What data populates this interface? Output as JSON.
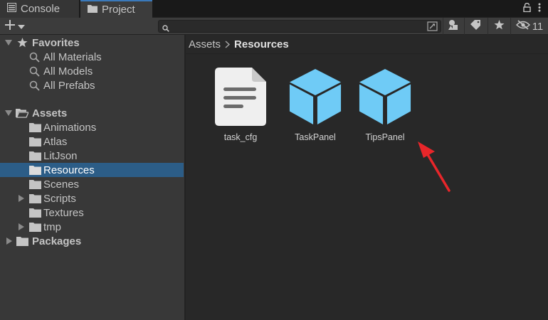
{
  "tabs": [
    {
      "label": "Console",
      "icon": "console-icon"
    },
    {
      "label": "Project",
      "icon": "folder-icon",
      "active": true
    }
  ],
  "toolbar": {
    "search_value": "",
    "hidden_count": "11"
  },
  "favorites": {
    "label": "Favorites",
    "items": [
      "All Materials",
      "All Models",
      "All Prefabs"
    ]
  },
  "assets": {
    "label": "Assets",
    "folders": [
      {
        "label": "Animations",
        "expandable": false
      },
      {
        "label": "Atlas",
        "expandable": false
      },
      {
        "label": "LitJson",
        "expandable": false
      },
      {
        "label": "Resources",
        "expandable": false,
        "selected": true
      },
      {
        "label": "Scenes",
        "expandable": false
      },
      {
        "label": "Scripts",
        "expandable": true
      },
      {
        "label": "Textures",
        "expandable": false
      },
      {
        "label": "tmp",
        "expandable": true
      }
    ]
  },
  "packages": {
    "label": "Packages"
  },
  "breadcrumb": [
    "Assets",
    "Resources"
  ],
  "content_items": [
    {
      "label": "task_cfg",
      "icon": "text-file-icon"
    },
    {
      "label": "TaskPanel",
      "icon": "prefab-cube-icon"
    },
    {
      "label": "TipsPanel",
      "icon": "prefab-cube-icon"
    }
  ],
  "colors": {
    "selection": "#2c5d87",
    "prefab": "#6fcbf6",
    "annotation_arrow": "#e8262a",
    "active_tab_accent": "#3a79bb"
  }
}
